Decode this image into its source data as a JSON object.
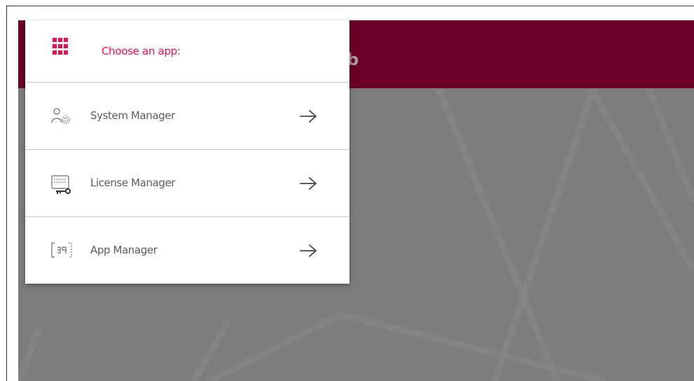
{
  "header": {
    "title_fragment": "ub",
    "color": "#6a0026"
  },
  "app_menu": {
    "heading": "Choose an app:",
    "heading_icon": "app-grid-icon",
    "accent_color": "#e2134f",
    "items": [
      {
        "label": "System Manager",
        "icon": "users-gear-icon"
      },
      {
        "label": "License Manager",
        "icon": "license-key-icon"
      },
      {
        "label": "App Manager",
        "icon": "app-code-icon"
      }
    ]
  }
}
